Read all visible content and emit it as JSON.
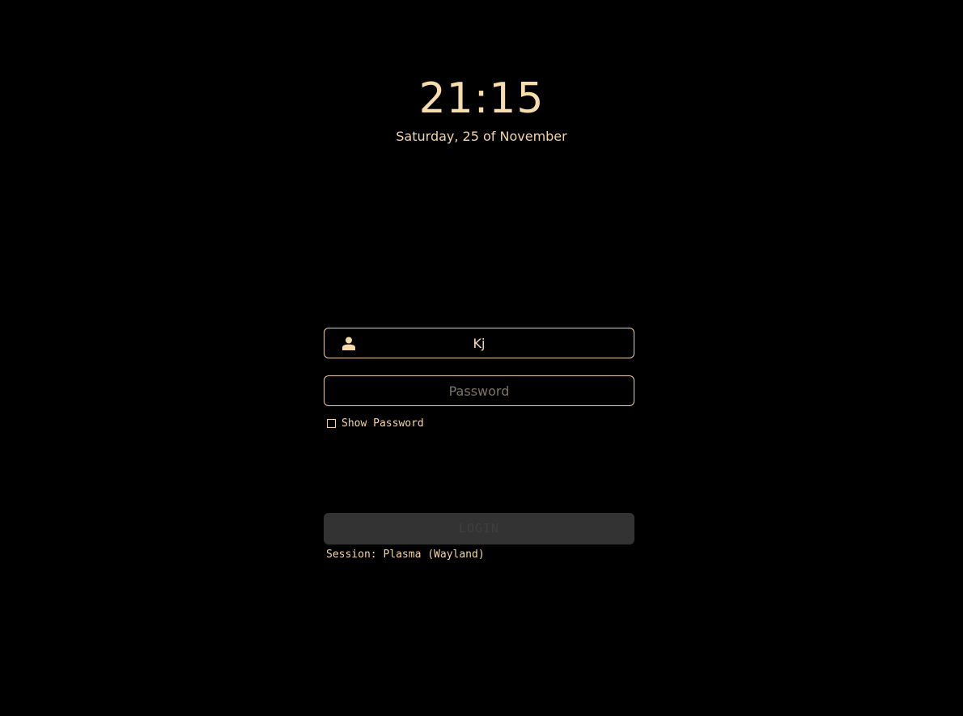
{
  "clock": {
    "time": "21:15",
    "date": "Saturday, 25 of November"
  },
  "login_form": {
    "username": {
      "value": "Kj",
      "icon": "user-icon"
    },
    "password": {
      "placeholder": "Password",
      "value": ""
    },
    "show_password": {
      "label": "Show Password",
      "checked": false
    },
    "login_button": {
      "label": "LOGIN",
      "enabled": false
    },
    "session": {
      "label": "Session: Plasma (Wayland)"
    }
  },
  "colors": {
    "background": "#000000",
    "accent": "#f5d9a8",
    "placeholder": "#7d7466",
    "button_disabled_bg": "#333333",
    "button_disabled_text": "#3f3f3f"
  }
}
